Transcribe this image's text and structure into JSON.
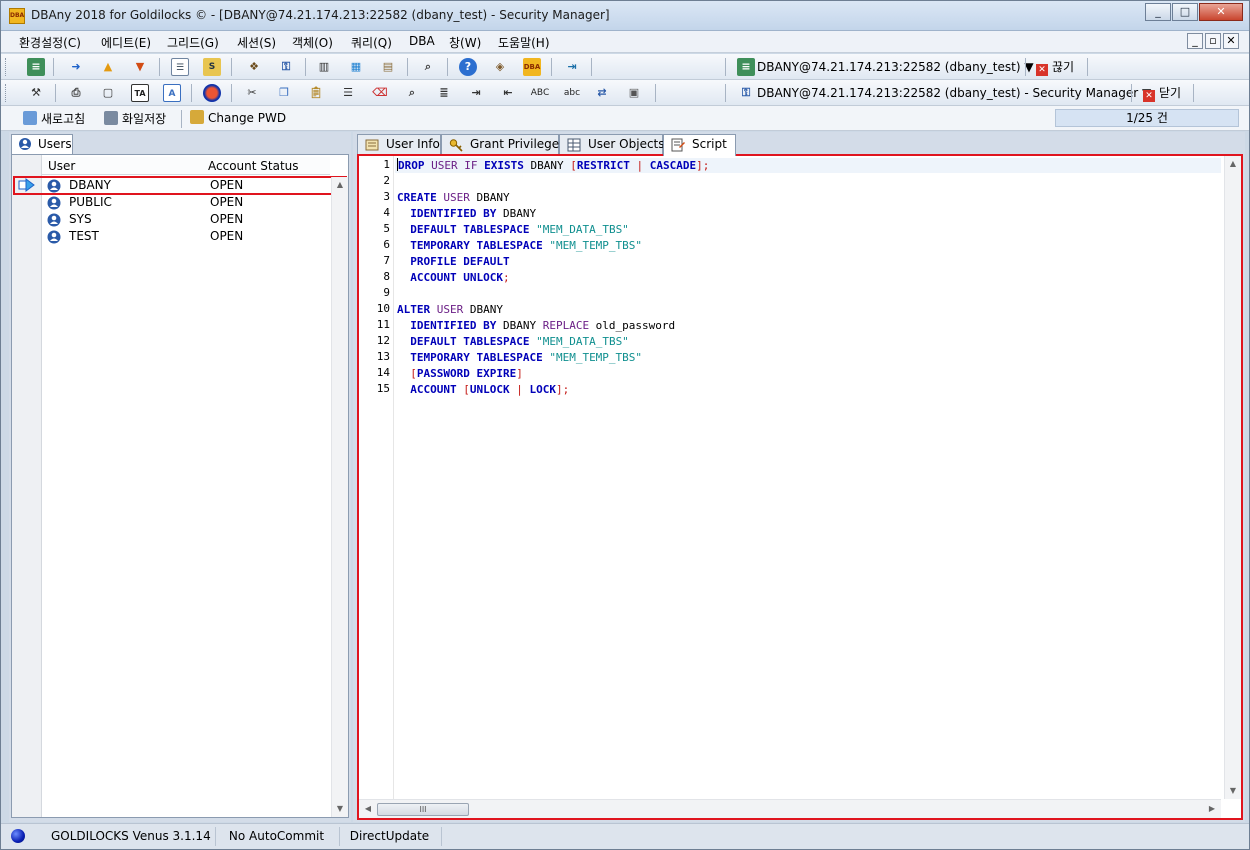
{
  "window": {
    "title": "DBAny 2018 for Goldilocks © - [DBANY@74.21.174.213:22582 (dbany_test) - Security Manager]",
    "icon_text": "DBA",
    "controls": {
      "minimize": "_",
      "maximize": "□",
      "close": "✕"
    }
  },
  "menu": {
    "items": [
      "환경설정(C)",
      "에디트(E)",
      "그리드(G)",
      "세션(S)",
      "객체(O)",
      "쿼리(Q)",
      "DBA",
      "창(W)",
      "도움말(H)"
    ],
    "mdi_controls": {
      "minimize": "_",
      "restore": "▫",
      "close": "✕"
    }
  },
  "toolbar1": {
    "connection_label": "DBANY@74.21.174.213:22582 (dbany_test) ▼",
    "disconnect_label": "끊기"
  },
  "toolbar2": {
    "abc_upper": "ABC",
    "abc_lower": "abc",
    "window_label": "DBANY@74.21.174.213:22582 (dbany_test) - Security Manager ▼",
    "close_label": "닫기"
  },
  "actions": {
    "refresh": "새로고침",
    "save_file": "화일저장",
    "change_pwd": "Change PWD",
    "record_counter": "1/25 건"
  },
  "left": {
    "tab_label": "Users",
    "columns": {
      "user": "User",
      "status": "Account Status"
    },
    "rows": [
      {
        "user": "DBANY",
        "status": "OPEN"
      },
      {
        "user": "PUBLIC",
        "status": "OPEN"
      },
      {
        "user": "SYS",
        "status": "OPEN"
      },
      {
        "user": "TEST",
        "status": "OPEN"
      }
    ],
    "selected_index": 0
  },
  "right": {
    "tabs": [
      "User Info",
      "Grant Privileges",
      "User Objects",
      "Script"
    ],
    "active_tab": "Script",
    "script_lines": [
      [
        {
          "t": "DROP",
          "c": "kw"
        },
        {
          "t": " "
        },
        {
          "t": "USER",
          "c": "kw2"
        },
        {
          "t": " "
        },
        {
          "t": "IF",
          "c": "kw2"
        },
        {
          "t": " "
        },
        {
          "t": "EXISTS",
          "c": "kw"
        },
        {
          "t": " DBANY "
        },
        {
          "t": "[",
          "c": "br"
        },
        {
          "t": "RESTRICT",
          "c": "kw"
        },
        {
          "t": " "
        },
        {
          "t": "|",
          "c": "br"
        },
        {
          "t": " "
        },
        {
          "t": "CASCADE",
          "c": "kw"
        },
        {
          "t": "];",
          "c": "br"
        }
      ],
      [],
      [
        {
          "t": "CREATE",
          "c": "kw"
        },
        {
          "t": " "
        },
        {
          "t": "USER",
          "c": "kw2"
        },
        {
          "t": " DBANY"
        }
      ],
      [
        {
          "t": "  "
        },
        {
          "t": "IDENTIFIED BY",
          "c": "kw"
        },
        {
          "t": " DBANY"
        }
      ],
      [
        {
          "t": "  "
        },
        {
          "t": "DEFAULT TABLESPACE",
          "c": "kw"
        },
        {
          "t": " "
        },
        {
          "t": "\"MEM_DATA_TBS\"",
          "c": "str"
        }
      ],
      [
        {
          "t": "  "
        },
        {
          "t": "TEMPORARY TABLESPACE",
          "c": "kw"
        },
        {
          "t": " "
        },
        {
          "t": "\"MEM_TEMP_TBS\"",
          "c": "str"
        }
      ],
      [
        {
          "t": "  "
        },
        {
          "t": "PROFILE DEFAULT",
          "c": "kw"
        }
      ],
      [
        {
          "t": "  "
        },
        {
          "t": "ACCOUNT UNLOCK",
          "c": "kw"
        },
        {
          "t": ";",
          "c": "br"
        }
      ],
      [],
      [
        {
          "t": "ALTER",
          "c": "kw"
        },
        {
          "t": " "
        },
        {
          "t": "USER",
          "c": "kw2"
        },
        {
          "t": " DBANY"
        }
      ],
      [
        {
          "t": "  "
        },
        {
          "t": "IDENTIFIED BY",
          "c": "kw"
        },
        {
          "t": " DBANY "
        },
        {
          "t": "REPLACE",
          "c": "kw2"
        },
        {
          "t": " old_password"
        }
      ],
      [
        {
          "t": "  "
        },
        {
          "t": "DEFAULT TABLESPACE",
          "c": "kw"
        },
        {
          "t": " "
        },
        {
          "t": "\"MEM_DATA_TBS\"",
          "c": "str"
        }
      ],
      [
        {
          "t": "  "
        },
        {
          "t": "TEMPORARY TABLESPACE",
          "c": "kw"
        },
        {
          "t": " "
        },
        {
          "t": "\"MEM_TEMP_TBS\"",
          "c": "str"
        }
      ],
      [
        {
          "t": "  "
        },
        {
          "t": "[",
          "c": "br"
        },
        {
          "t": "PASSWORD EXPIRE",
          "c": "kw"
        },
        {
          "t": "]",
          "c": "br"
        }
      ],
      [
        {
          "t": "  "
        },
        {
          "t": "ACCOUNT",
          "c": "kw"
        },
        {
          "t": " "
        },
        {
          "t": "[",
          "c": "br"
        },
        {
          "t": "UNLOCK",
          "c": "kw"
        },
        {
          "t": " "
        },
        {
          "t": "|",
          "c": "br"
        },
        {
          "t": " "
        },
        {
          "t": "LOCK",
          "c": "kw"
        },
        {
          "t": "];",
          "c": "br"
        }
      ]
    ],
    "hscroll_thumb_text": "III"
  },
  "status": {
    "server": "GOLDILOCKS Venus 3.1.14",
    "commit_mode": "No AutoCommit",
    "update_mode": "DirectUpdate"
  },
  "colors": {
    "highlight_border": "#e0141e",
    "keyword": "#0000b8",
    "keyword_secondary": "#6b1f86",
    "string": "#0f8f8f",
    "bracket": "#c41a16"
  }
}
